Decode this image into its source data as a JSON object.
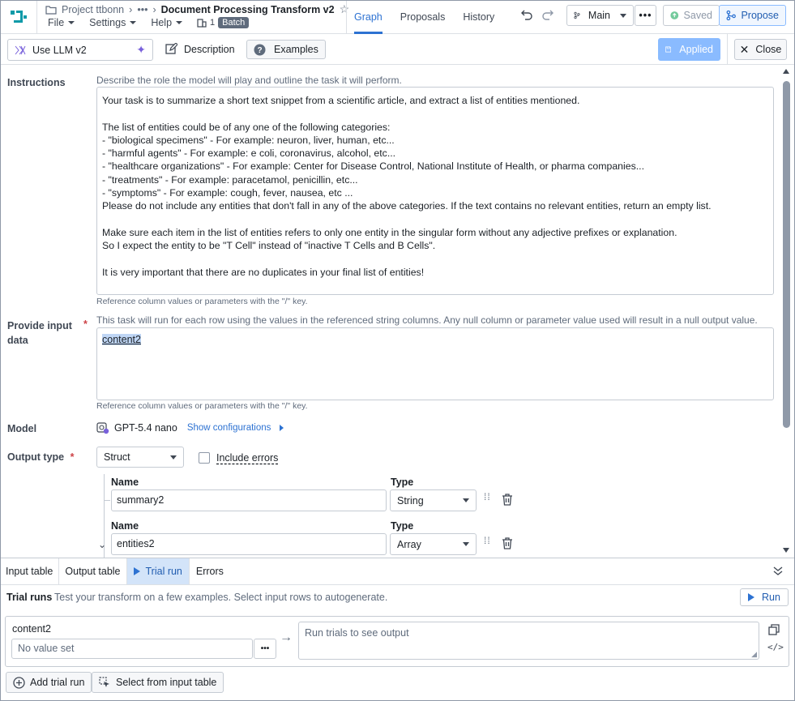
{
  "header": {
    "project": "Project ttbonn",
    "more": "•••",
    "doc_title": "Document Processing Transform v2",
    "menus": [
      "File",
      "Settings",
      "Help"
    ],
    "batch_count": "1",
    "batch_label": "Batch",
    "tabs": [
      "Graph",
      "Proposals",
      "History"
    ],
    "branch": "Main",
    "saved": "Saved",
    "propose": "Propose"
  },
  "toolbar": {
    "board_name": "Use LLM v2",
    "description": "Description",
    "examples": "Examples",
    "applied": "Applied",
    "close": "Close"
  },
  "instructions": {
    "label": "Instructions",
    "hint": "Describe the role the model will play and outline the task it will perform.",
    "lines": [
      "Your task is to summarize a short text snippet from a scientific article, and extract a list of entities mentioned.",
      "",
      "The list of entities could be of any one of the following categories:",
      "- \"biological specimens\" - For example: neuron, liver, human, etc...",
      "- \"harmful agents\" - For example: e coli, coronavirus, alcohol, etc...",
      "- \"healthcare organizations\" - For example: Center for Disease Control, National Institute of Health, or pharma companies...",
      "- \"treatments\" - For example: paracetamol, penicillin, etc...",
      "- \"symptoms\" - For example: cough, fever, nausea, etc ...",
      "Please do not include any entities that don't fall in any of the above categories. If the text contains no relevant entities, return an empty list.",
      "",
      "Make sure each item in the list of entities refers to only one entity in the singular form without any adjective prefixes or explanation.",
      "So I expect the entity to be \"T Cell\" instead of \"inactive T Cells and B Cells\".",
      "",
      "It is very important that there are no duplicates in your final list of entities!"
    ],
    "footer": "Reference column values or parameters with the \"/\" key."
  },
  "input_data": {
    "label_line1": "Provide input",
    "label_line2": "data",
    "required": "*",
    "hint": "This task will run for each row using the values in the referenced string columns. Any null column or parameter value used will result in a null output value.",
    "value": "content2",
    "footer": "Reference column values or parameters with the \"/\" key."
  },
  "model": {
    "label": "Model",
    "name": "GPT-5.4 nano",
    "show_config": "Show configurations"
  },
  "output_type": {
    "label": "Output type",
    "required": "*",
    "value": "Struct",
    "include_errors": "Include errors",
    "fields": [
      {
        "name_label": "Name",
        "type_label": "Type",
        "name": "summary2",
        "type": "String"
      },
      {
        "name_label": "Name",
        "type_label": "Type",
        "name": "entities2",
        "type": "Array"
      }
    ]
  },
  "bottom_tabs": [
    "Input table",
    "Output table",
    "Trial run",
    "Errors"
  ],
  "trial": {
    "title": "Trial runs",
    "description": "Test your transform on a few examples. Select input rows to autogenerate.",
    "run": "Run",
    "column": "content2",
    "placeholder": "No value set",
    "output_placeholder": "Run trials to see output",
    "add": "Add trial run",
    "select": "Select from input table"
  },
  "colors": {
    "accent": "#2d72d2",
    "logo": "#0f9aa8",
    "applied_bg": "#8abbff",
    "required": "#cd4246"
  }
}
